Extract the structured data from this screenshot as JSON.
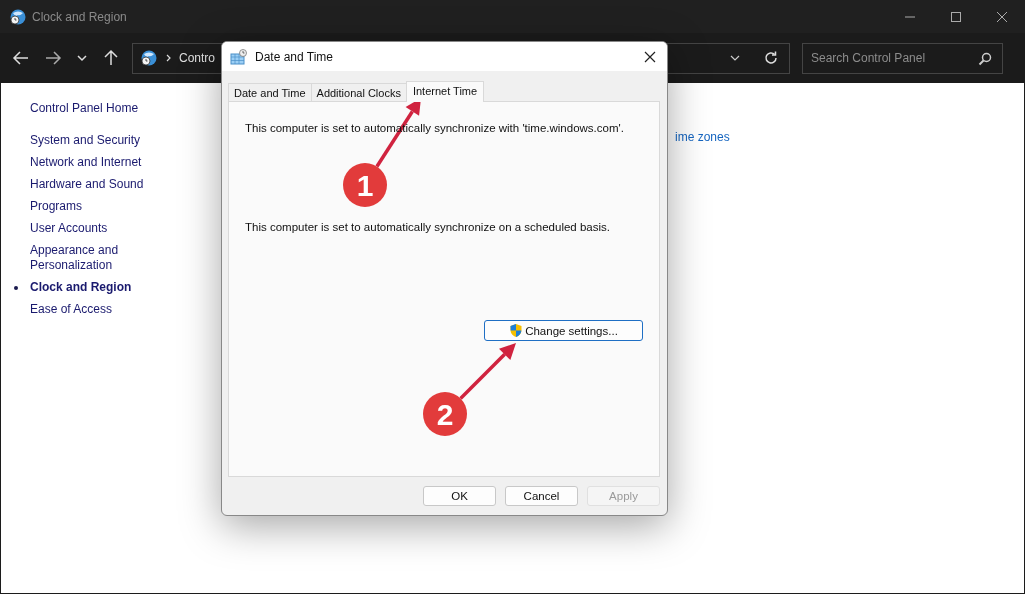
{
  "window": {
    "title": "Clock and Region"
  },
  "toolbar": {
    "address": "Contro",
    "search": {
      "placeholder": "Search Control Panel"
    }
  },
  "sidebar": {
    "home": "Control Panel Home",
    "items": [
      {
        "label": "System and Security",
        "selected": false
      },
      {
        "label": "Network and Internet",
        "selected": false
      },
      {
        "label": "Hardware and Sound",
        "selected": false
      },
      {
        "label": "Programs",
        "selected": false
      },
      {
        "label": "User Accounts",
        "selected": false
      },
      {
        "label": "Appearance and Personalization",
        "selected": false
      },
      {
        "label": "Clock and Region",
        "selected": true
      },
      {
        "label": "Ease of Access",
        "selected": false
      }
    ]
  },
  "content": {
    "link": "ime zones"
  },
  "dialog": {
    "title": "Date and Time",
    "tabs": [
      {
        "label": "Date and Time",
        "selected": false
      },
      {
        "label": "Additional Clocks",
        "selected": false
      },
      {
        "label": "Internet Time",
        "selected": true
      }
    ],
    "messages": [
      "This computer is set to automatically synchronize with 'time.windows.com'.",
      "This computer is set to automatically synchronize on a scheduled basis."
    ],
    "change_button": "Change settings...",
    "buttons": [
      {
        "label": "OK",
        "disabled": false
      },
      {
        "label": "Cancel",
        "disabled": false
      },
      {
        "label": "Apply",
        "disabled": true
      }
    ]
  },
  "annotations": [
    {
      "label": "1"
    },
    {
      "label": "2"
    }
  ]
}
